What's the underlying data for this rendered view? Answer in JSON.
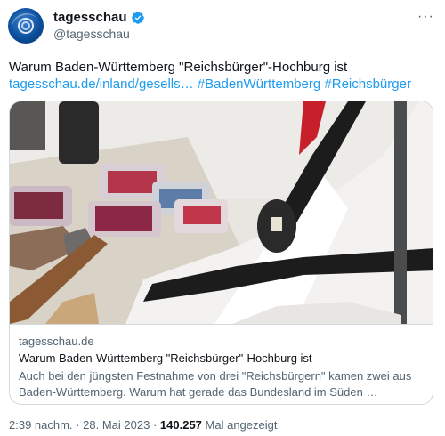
{
  "author": {
    "name": "tagesschau",
    "handle": "@tagesschau",
    "verified": true,
    "brand_color": "#0b4f9b"
  },
  "tweet": {
    "text": "Warum Baden-Württemberg \"Reichsbürger\"-Hochburg ist",
    "link": "tagesschau.de/inland/gesells…",
    "hashtags": [
      "#BadenWürttemberg",
      "#Reichsbürger"
    ]
  },
  "more_menu": "···",
  "card": {
    "image_icon": "photo-flag-icon",
    "domain": "tagesschau.de",
    "title": "Warum Baden-Württemberg \"Reichsbürger\"-Hochburg ist",
    "description": "Auch bei den jüngsten Festnahme von drei \"Reichsbürgern\" kamen zwei aus Baden-Württemberg. Warum hat gerade das Bundesland im Süden …"
  },
  "meta": {
    "time": "2:39 nachm.",
    "separator": "·",
    "date": "28. Mai 2023",
    "views": "140.257",
    "views_label": "Mal angezeigt"
  },
  "colors": {
    "link": "#1d9bf0",
    "secondary_text": "#536471",
    "border": "#cfd9de"
  }
}
